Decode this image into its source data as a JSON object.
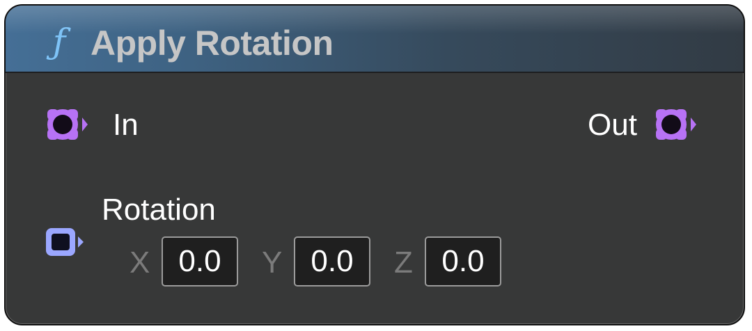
{
  "node": {
    "title": "Apply Rotation",
    "icon": "function-icon",
    "header_color": "#456f96"
  },
  "pins": {
    "exec_in": {
      "label": "In",
      "color": "#b772f5"
    },
    "exec_out": {
      "label": "Out",
      "color": "#b772f5"
    },
    "rotation": {
      "label": "Rotation",
      "color": "#9ba7ff",
      "x_label": "X",
      "x_value": "0.0",
      "y_label": "Y",
      "y_value": "0.0",
      "z_label": "Z",
      "z_value": "0.0"
    }
  }
}
